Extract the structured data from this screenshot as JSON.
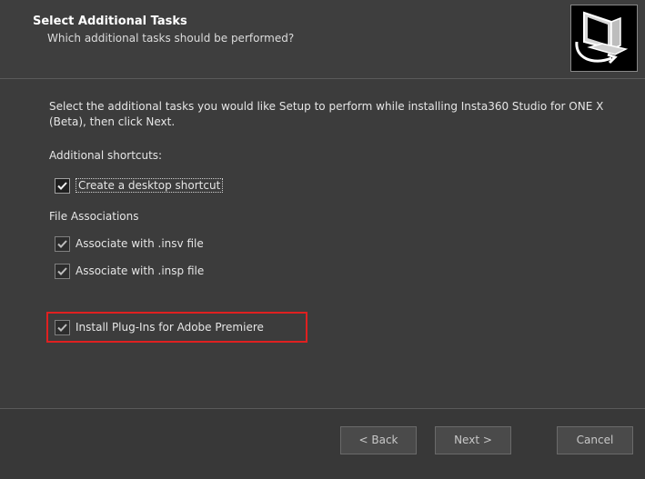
{
  "header": {
    "title": "Select Additional Tasks",
    "subtitle": "Which additional tasks should be performed?",
    "icon": "setup-computer-icon"
  },
  "main": {
    "intro": "Select the additional tasks you would like Setup to perform while installing Insta360 Studio for ONE X (Beta), then click Next.",
    "shortcuts_label": "Additional shortcuts:",
    "desktop_shortcut": {
      "label": "Create a desktop shortcut",
      "checked": true
    },
    "file_assoc_label": "File Associations",
    "assoc_insv": {
      "label": "Associate with .insv file",
      "checked": true
    },
    "assoc_insp": {
      "label": "Associate with .insp file",
      "checked": true
    },
    "plugins": {
      "label": "Install Plug-Ins for Adobe Premiere",
      "checked": true
    }
  },
  "footer": {
    "back_label": "< Back",
    "next_label": "Next >",
    "cancel_label": "Cancel"
  },
  "colors": {
    "background": "#3c3c3c",
    "highlight": "#e02020"
  }
}
